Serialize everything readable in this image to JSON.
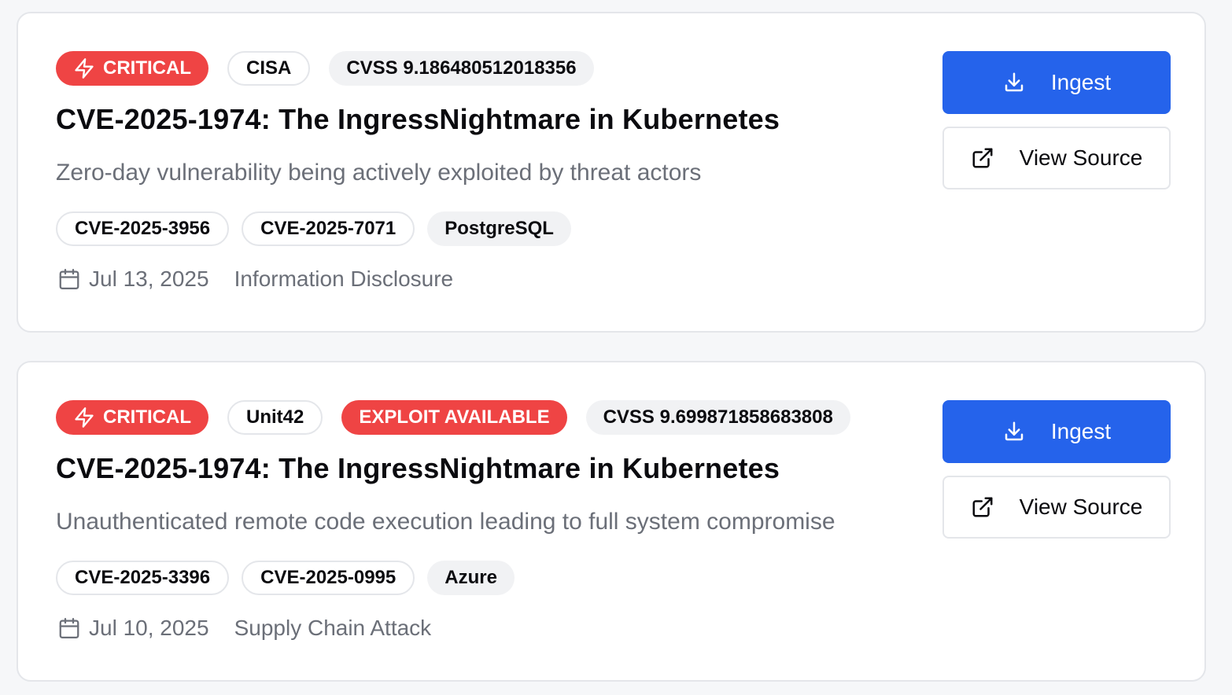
{
  "colors": {
    "critical": "#ef4444",
    "primary": "#2563eb",
    "muted_text": "#6b6f78",
    "border": "#e4e6ea"
  },
  "cards": [
    {
      "severity_label": "CRITICAL",
      "severity_icon": "lightning-icon",
      "source": "CISA",
      "exploit_label": null,
      "cvss": "CVSS 9.186480512018356",
      "title": "CVE-2025-1974: The IngressNightmare in Kubernetes",
      "description": "Zero-day vulnerability being actively exploited by threat actors",
      "tags": [
        "CVE-2025-3956",
        "CVE-2025-7071",
        "PostgreSQL"
      ],
      "date": "Jul 13, 2025",
      "category": "Information Disclosure",
      "ingest_label": "Ingest",
      "view_source_label": "View Source"
    },
    {
      "severity_label": "CRITICAL",
      "severity_icon": "lightning-icon",
      "source": "Unit42",
      "exploit_label": "EXPLOIT AVAILABLE",
      "cvss": "CVSS 9.699871858683808",
      "title": "CVE-2025-1974: The IngressNightmare in Kubernetes",
      "description": "Unauthenticated remote code execution leading to full system compromise",
      "tags": [
        "CVE-2025-3396",
        "CVE-2025-0995",
        "Azure"
      ],
      "date": "Jul 10, 2025",
      "category": "Supply Chain Attack",
      "ingest_label": "Ingest",
      "view_source_label": "View Source"
    }
  ]
}
